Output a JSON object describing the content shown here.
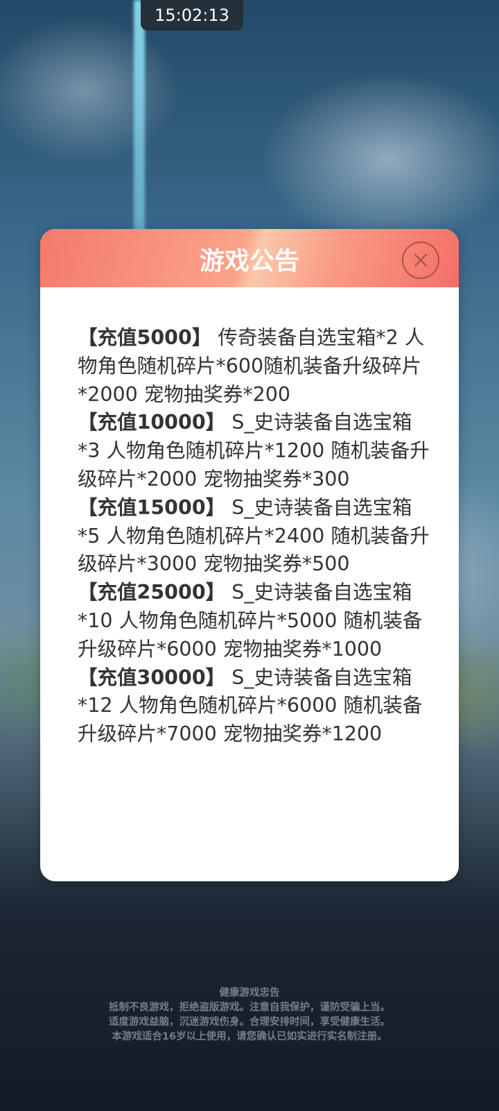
{
  "status": {
    "time": "15:02:13"
  },
  "modal": {
    "title": "游戏公告",
    "close_icon": "close-icon",
    "entries": [
      {
        "tier": "【充值5000】",
        "text": "传奇装备自选宝箱*2 人物角色随机碎片*600随机装备升级碎片*2000 宠物抽奖券*200"
      },
      {
        "tier": "【充值10000】",
        "text": "S_史诗装备自选宝箱*3 人物角色随机碎片*1200 随机装备升级碎片*2000 宠物抽奖券*300"
      },
      {
        "tier": "【充值15000】",
        "text": "S_史诗装备自选宝箱*5 人物角色随机碎片*2400 随机装备升级碎片*3000 宠物抽奖券*500"
      },
      {
        "tier": "【充值25000】",
        "text": "S_史诗装备自选宝箱*10 人物角色随机碎片*5000 随机装备升级碎片*6000 宠物抽奖券*1000"
      },
      {
        "tier": "【充值30000】",
        "text": "S_史诗装备自选宝箱*12 人物角色随机碎片*6000 随机装备升级碎片*7000 宠物抽奖券*1200"
      }
    ]
  },
  "advisory": {
    "title": "健康游戏忠告",
    "line1": "抵制不良游戏，拒绝盗版游戏。注意自我保护，谨防受骗上当。",
    "line2": "适度游戏益脑，沉迷游戏伤身。合理安排时间，享受健康生活。",
    "line3": "本游戏适合16岁以上使用，请您确认已如实进行实名制注册。"
  },
  "colors": {
    "header_start": "#f47a6b",
    "header_end": "#f56f67",
    "text": "#333333"
  }
}
